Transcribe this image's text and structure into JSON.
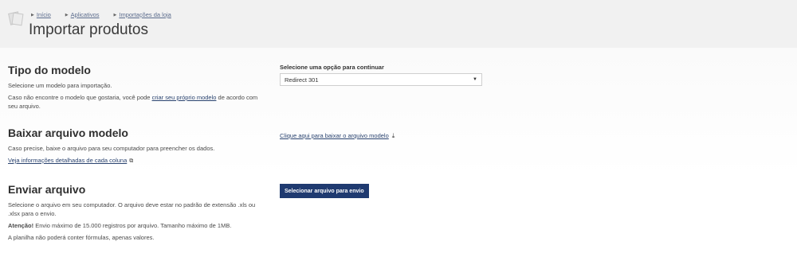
{
  "header": {
    "breadcrumb": [
      "Início",
      "Aplicativos",
      "Importações da loja"
    ],
    "title": "Importar produtos"
  },
  "model": {
    "title": "Tipo do modelo",
    "desc": "Selecione um modelo para importação.",
    "note_pre": "Caso não encontre o modelo que gostaria, você pode",
    "note_link": "criar seu próprio modelo",
    "note_post": "de acordo com seu arquivo.",
    "select_label": "Selecione uma opção para continuar",
    "select_value": "Redirect 301"
  },
  "download": {
    "title": "Baixar arquivo modelo",
    "desc": "Caso precise, baixe o arquivo para seu computador para preencher os dados.",
    "details_link": "Veja informações detalhadas de cada coluna",
    "download_link": "Clique aqui para baixar o arquivo modelo"
  },
  "send": {
    "title": "Enviar arquivo",
    "desc": "Selecione o arquivo em seu computador. O arquivo deve estar no padrão de extensão .xls ou .xlsx para o envio.",
    "attention_label": "Atenção!",
    "attention_text": "Envio máximo de 15.000 registros por arquivo. Tamanho máximo de 1MB.",
    "formula_note": "A planilha não poderá conter fórmulas, apenas valores.",
    "button_label": "Selecionar arquivo para envio"
  }
}
